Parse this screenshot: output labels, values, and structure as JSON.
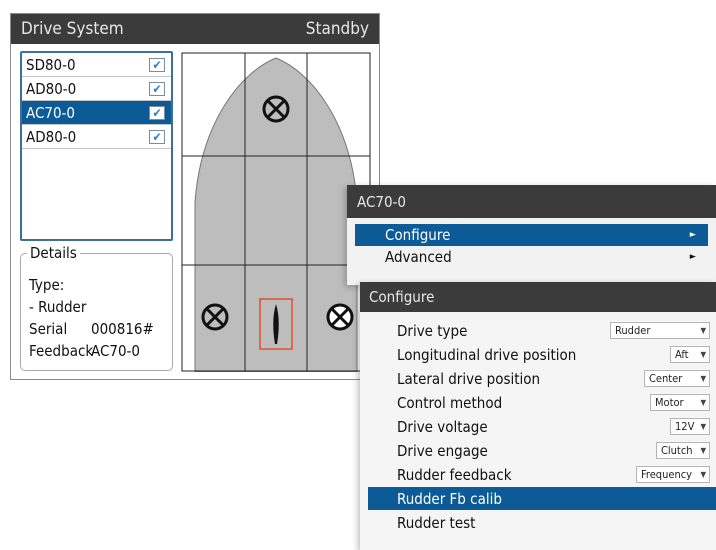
{
  "drive_system": {
    "title": "Drive System",
    "status": "Standby",
    "drives": [
      {
        "name": "SD80-0",
        "checked": true
      },
      {
        "name": "AD80-0",
        "checked": true
      },
      {
        "name": "AC70-0",
        "checked": true,
        "selected": true
      },
      {
        "name": "AD80-0",
        "checked": true
      }
    ],
    "check_glyph": "✔",
    "details": {
      "legend": "Details",
      "type_label": "Type:",
      "type_value": "- Rudder",
      "serial_label": "Serial",
      "serial_value": "000816#",
      "feedback_label": "Feedback",
      "feedback_value": "AC70-0"
    }
  },
  "menu": {
    "title": "AC70-0",
    "items": [
      {
        "label": "Configure",
        "arrow": "►"
      },
      {
        "label": "Advanced",
        "arrow": "►"
      }
    ]
  },
  "configure": {
    "title": "Configure",
    "rows": [
      {
        "label": "Drive type",
        "value": "Rudder"
      },
      {
        "label": "Longitudinal drive position",
        "value": "Aft"
      },
      {
        "label": "Lateral drive position",
        "value": "Center"
      },
      {
        "label": "Control method",
        "value": "Motor"
      },
      {
        "label": "Drive voltage",
        "value": "12V"
      },
      {
        "label": "Drive engage",
        "value": "Clutch"
      },
      {
        "label": "Rudder feedback",
        "value": "Frequency"
      },
      {
        "label": "Rudder Fb calib"
      },
      {
        "label": "Rudder test"
      }
    ],
    "caret": "▼"
  },
  "colors": {
    "titlebar": "#3b3b3b",
    "selection": "#0c5b97",
    "hull": "#bdbdbd",
    "rudder_marker": "#e0502a"
  }
}
